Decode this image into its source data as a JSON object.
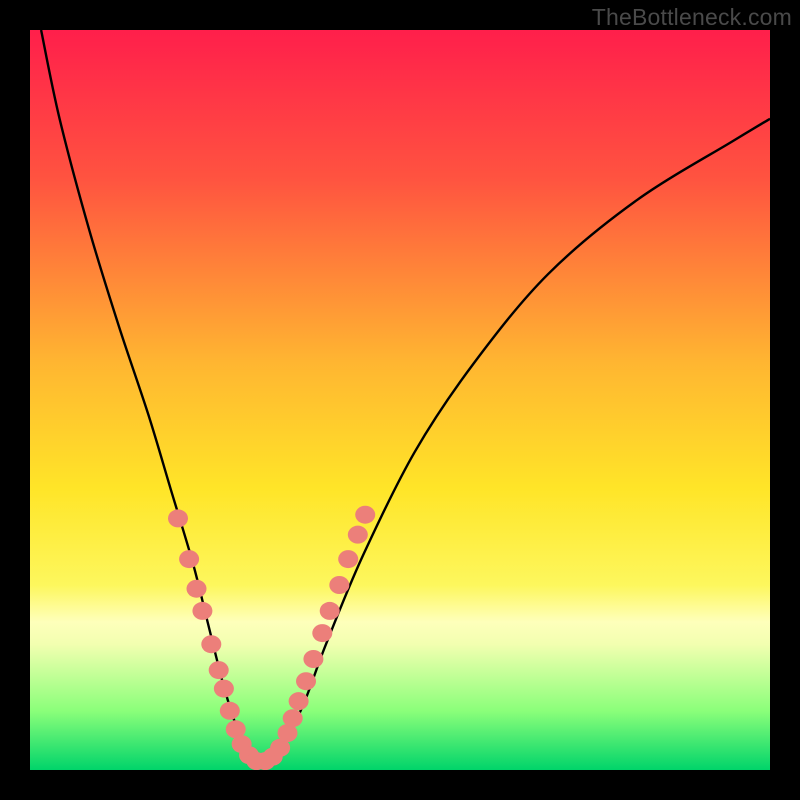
{
  "watermark": "TheBottleneck.com",
  "chart_data": {
    "type": "line",
    "title": "",
    "xlabel": "",
    "ylabel": "",
    "x_range": [
      0,
      100
    ],
    "y_range": [
      0,
      100
    ],
    "gradient_stops": [
      {
        "pct": 0,
        "color": "#ff1f4b"
      },
      {
        "pct": 20,
        "color": "#ff5340"
      },
      {
        "pct": 45,
        "color": "#ffb631"
      },
      {
        "pct": 62,
        "color": "#ffe528"
      },
      {
        "pct": 75,
        "color": "#fdf75d"
      },
      {
        "pct": 80,
        "color": "#feffbb"
      },
      {
        "pct": 83,
        "color": "#f2ffb0"
      },
      {
        "pct": 92,
        "color": "#8bff7a"
      },
      {
        "pct": 100,
        "color": "#00d46a"
      }
    ],
    "series": [
      {
        "name": "bottleneck-curve",
        "x": [
          1.5,
          4,
          8,
          12,
          16,
          19,
          22,
          24,
          26,
          27.5,
          29,
          30.2,
          31.5,
          34,
          37,
          40,
          45,
          52,
          60,
          70,
          82,
          95,
          100
        ],
        "y": [
          100,
          88,
          73,
          60,
          48,
          38,
          28,
          20,
          12,
          7,
          3,
          1,
          1,
          3,
          9,
          17,
          29,
          43,
          55,
          67,
          77,
          85,
          88
        ]
      }
    ],
    "markers": [
      {
        "x": 20.0,
        "y": 34.0
      },
      {
        "x": 21.5,
        "y": 28.5
      },
      {
        "x": 22.5,
        "y": 24.5
      },
      {
        "x": 23.3,
        "y": 21.5
      },
      {
        "x": 24.5,
        "y": 17.0
      },
      {
        "x": 25.5,
        "y": 13.5
      },
      {
        "x": 26.2,
        "y": 11.0
      },
      {
        "x": 27.0,
        "y": 8.0
      },
      {
        "x": 27.8,
        "y": 5.5
      },
      {
        "x": 28.6,
        "y": 3.5
      },
      {
        "x": 29.6,
        "y": 2.0
      },
      {
        "x": 30.6,
        "y": 1.2
      },
      {
        "x": 31.8,
        "y": 1.2
      },
      {
        "x": 32.8,
        "y": 1.8
      },
      {
        "x": 33.8,
        "y": 3.0
      },
      {
        "x": 34.8,
        "y": 5.0
      },
      {
        "x": 35.5,
        "y": 7.0
      },
      {
        "x": 36.3,
        "y": 9.3
      },
      {
        "x": 37.3,
        "y": 12.0
      },
      {
        "x": 38.3,
        "y": 15.0
      },
      {
        "x": 39.5,
        "y": 18.5
      },
      {
        "x": 40.5,
        "y": 21.5
      },
      {
        "x": 41.8,
        "y": 25.0
      },
      {
        "x": 43.0,
        "y": 28.5
      },
      {
        "x": 44.3,
        "y": 31.8
      },
      {
        "x": 45.3,
        "y": 34.5
      }
    ],
    "marker_color": "#ec7f7a",
    "curve_color": "#000000"
  }
}
